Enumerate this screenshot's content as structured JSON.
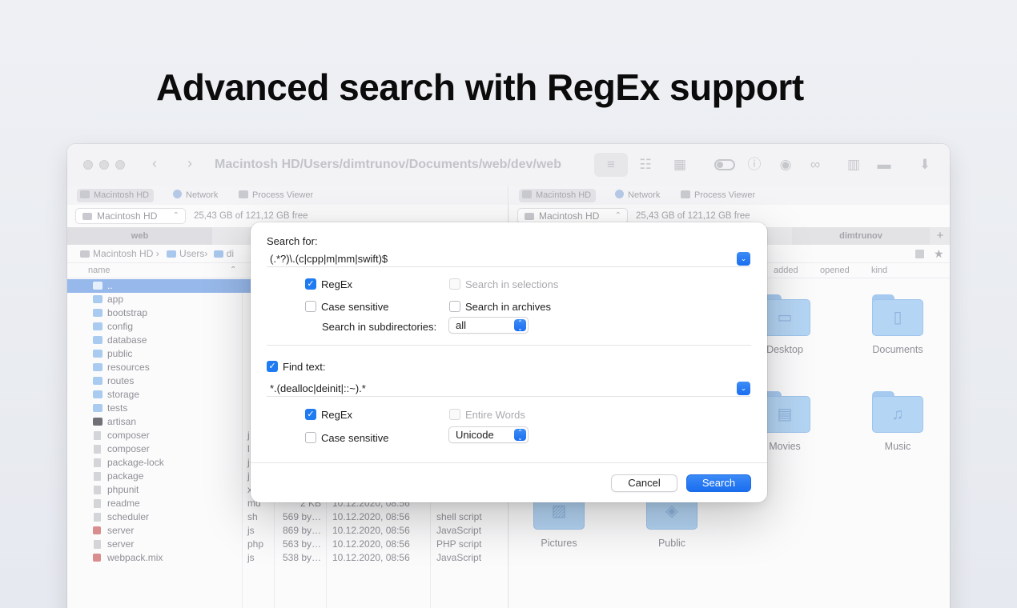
{
  "headline": "Advanced search with RegEx support",
  "window": {
    "path_title": "Macintosh HD/Users/dimtrunov/Documents/web/dev/web"
  },
  "left_pane": {
    "favorites": [
      "Macintosh HD",
      "Network",
      "Process Viewer"
    ],
    "drive": "Macintosh HD",
    "free_space": "25,43 GB of 121,12 GB free",
    "tab": "web",
    "breadcrumb": [
      "Macintosh HD ›",
      "Users›",
      "di"
    ],
    "column_name": "name",
    "rows": [
      {
        "name": "..",
        "icon": "folder",
        "ext": "",
        "size": "",
        "date": "",
        "kind": ""
      },
      {
        "name": "app",
        "icon": "folder",
        "ext": "",
        "size": "",
        "date": "",
        "kind": ""
      },
      {
        "name": "bootstrap",
        "icon": "folder",
        "ext": "",
        "size": "",
        "date": "",
        "kind": ""
      },
      {
        "name": "config",
        "icon": "folder",
        "ext": "",
        "size": "",
        "date": "",
        "kind": ""
      },
      {
        "name": "database",
        "icon": "folder",
        "ext": "",
        "size": "",
        "date": "",
        "kind": ""
      },
      {
        "name": "public",
        "icon": "folder",
        "ext": "",
        "size": "",
        "date": "",
        "kind": ""
      },
      {
        "name": "resources",
        "icon": "folder",
        "ext": "",
        "size": "",
        "date": "",
        "kind": ""
      },
      {
        "name": "routes",
        "icon": "folder",
        "ext": "",
        "size": "",
        "date": "",
        "kind": ""
      },
      {
        "name": "storage",
        "icon": "folder",
        "ext": "",
        "size": "",
        "date": "",
        "kind": ""
      },
      {
        "name": "tests",
        "icon": "folder",
        "ext": "",
        "size": "",
        "date": "",
        "kind": ""
      },
      {
        "name": "artisan",
        "icon": "exec",
        "ext": "",
        "size": "",
        "date": "",
        "kind": ""
      },
      {
        "name": "composer",
        "icon": "file",
        "ext": "j",
        "size": "",
        "date": "",
        "kind": ""
      },
      {
        "name": "composer",
        "icon": "file",
        "ext": "l",
        "size": "",
        "date": "",
        "kind": ""
      },
      {
        "name": "package-lock",
        "icon": "file",
        "ext": "j",
        "size": "",
        "date": "",
        "kind": ""
      },
      {
        "name": "package",
        "icon": "file",
        "ext": "j",
        "size": "",
        "date": "",
        "kind": ""
      },
      {
        "name": "phpunit",
        "icon": "file",
        "ext": "x",
        "size": "",
        "date": "",
        "kind": ""
      },
      {
        "name": "readme",
        "icon": "file",
        "ext": "md",
        "size": "2 KB",
        "date": "10.12.2020, 08:56",
        "kind": ""
      },
      {
        "name": "scheduler",
        "icon": "file",
        "ext": "sh",
        "size": "569 by…",
        "date": "10.12.2020, 08:56",
        "kind": "shell script"
      },
      {
        "name": "server",
        "icon": "script",
        "ext": "js",
        "size": "869 by…",
        "date": "10.12.2020, 08:56",
        "kind": "JavaScript"
      },
      {
        "name": "server",
        "icon": "file",
        "ext": "php",
        "size": "563 by…",
        "date": "10.12.2020, 08:56",
        "kind": "PHP script"
      },
      {
        "name": "webpack.mix",
        "icon": "script",
        "ext": "js",
        "size": "538 by…",
        "date": "10.12.2020, 08:56",
        "kind": "JavaScript"
      }
    ]
  },
  "right_pane": {
    "favorites": [
      "Macintosh HD",
      "Network",
      "Process Viewer"
    ],
    "drive": "Macintosh HD",
    "free_space": "25,43 GB of 121,12 GB free",
    "tab": "dimtrunov",
    "tab_add": "+",
    "columns": [
      "added",
      "opened",
      "kind"
    ],
    "grid": [
      {
        "name": "Desktop",
        "icon": "desktop-icon"
      },
      {
        "name": "Documents",
        "icon": "document-icon"
      },
      {
        "name": "Movies",
        "icon": "film-icon"
      },
      {
        "name": "Music",
        "icon": "music-icon"
      },
      {
        "name": "Pictures",
        "icon": "picture-icon"
      },
      {
        "name": "Public",
        "icon": "public-icon"
      }
    ]
  },
  "dialog": {
    "search_for_label": "Search for:",
    "search_for_value": "(.*?)\\.(c|cpp|m|mm|swift)$",
    "regex_label": "RegEx",
    "regex_checked": true,
    "search_in_selections_label": "Search in selections",
    "case_sensitive_label": "Case sensitive",
    "search_in_archives_label": "Search in archives",
    "subdirs_label": "Search in subdirectories:",
    "subdirs_value": "all",
    "find_text_label": "Find text:",
    "find_text_checked": true,
    "find_text_value": "*.(dealloc|deinit|::~).*",
    "regex2_label": "RegEx",
    "entire_words_label": "Entire Words",
    "case_sensitive2_label": "Case sensitive",
    "encoding_value": "Unicode",
    "cancel_label": "Cancel",
    "search_label": "Search",
    "accent_color": "#1f7bf2"
  }
}
